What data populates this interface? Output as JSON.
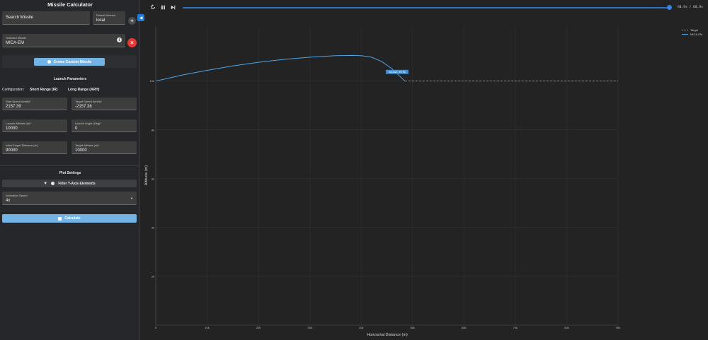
{
  "sidebar": {
    "title": "Missile Calculator",
    "search": {
      "placeholder": "Search Missile"
    },
    "version": {
      "label": "Default Version",
      "value": "local"
    },
    "add_symbol": "+",
    "selected": {
      "label": "Selected Missile",
      "value": "MICA-EM"
    },
    "remove_symbol": "×",
    "create_label": "Create Custom Missile",
    "launch_title": "Launch Parameters",
    "config": {
      "label": "Configuration:",
      "option_short": "Short Range (IR)",
      "option_long": "Long Range (ARH)"
    },
    "fields": {
      "start_speed": {
        "label": "Start Speed (km/h)*",
        "value": "2157.39"
      },
      "target_speed": {
        "label": "Target Speed (km/h)*",
        "value": "-2157.38"
      },
      "launch_alt": {
        "label": "Launch Altitude (m)*",
        "value": "10000"
      },
      "launch_angle": {
        "label": "Launch Angle (Deg)*",
        "value": "0"
      },
      "init_distance": {
        "label": "Initial Target Distance (m)",
        "value": "90000"
      },
      "target_alt": {
        "label": "Target Altitude (m)*",
        "value": "10000"
      }
    },
    "plot_title": "Plot Settings",
    "filter_label": "Filter Y-Axis Elements",
    "anim": {
      "label": "Animation Speed",
      "value": "4x"
    },
    "calculate_label": "Calculate"
  },
  "player": {
    "time": "68.9s / 68.9s",
    "progress": 1.0
  },
  "colors": {
    "accent": "#2f86e6",
    "button": "#74b3e6",
    "danger": "#e53935",
    "trajectory": "#4ea6e8",
    "target": "#9a9a9a"
  },
  "chart_data": {
    "type": "line",
    "xlabel": "Horizontal Distance (m)",
    "ylabel": "Altitude (m)",
    "xlim": [
      0,
      90000
    ],
    "ylim": [
      0,
      10500
    ],
    "x_ticks": [
      0,
      10000,
      20000,
      30000,
      40000,
      50000,
      60000,
      70000,
      80000,
      90000
    ],
    "x_tick_labels": [
      "0",
      "10k",
      "20k",
      "30k",
      "40k",
      "50k",
      "60k",
      "70k",
      "80k",
      "90k"
    ],
    "y_ticks": [
      2000,
      4000,
      6000,
      8000,
      10000
    ],
    "y_tick_labels": [
      "2k",
      "4k",
      "6k",
      "8k",
      "10k"
    ],
    "grid": true,
    "legend": "top-right",
    "series": [
      {
        "name": "Target",
        "style": "dashed",
        "x": [
          48500,
          90000
        ],
        "y": [
          10000,
          10000
        ]
      },
      {
        "name": "MICA-EM",
        "style": "solid",
        "x": [
          0,
          5000,
          10000,
          15000,
          20000,
          25000,
          30000,
          35000,
          38500,
          40000,
          42000,
          44000,
          46000,
          47500,
          48500
        ],
        "y": [
          10000,
          10240,
          10440,
          10620,
          10770,
          10890,
          10980,
          11040,
          11050,
          11040,
          10980,
          10800,
          10500,
          10200,
          10000
        ]
      }
    ],
    "annotations": [
      {
        "text": "Impact: 68.9s",
        "x": 48500,
        "y": 10000
      }
    ]
  }
}
